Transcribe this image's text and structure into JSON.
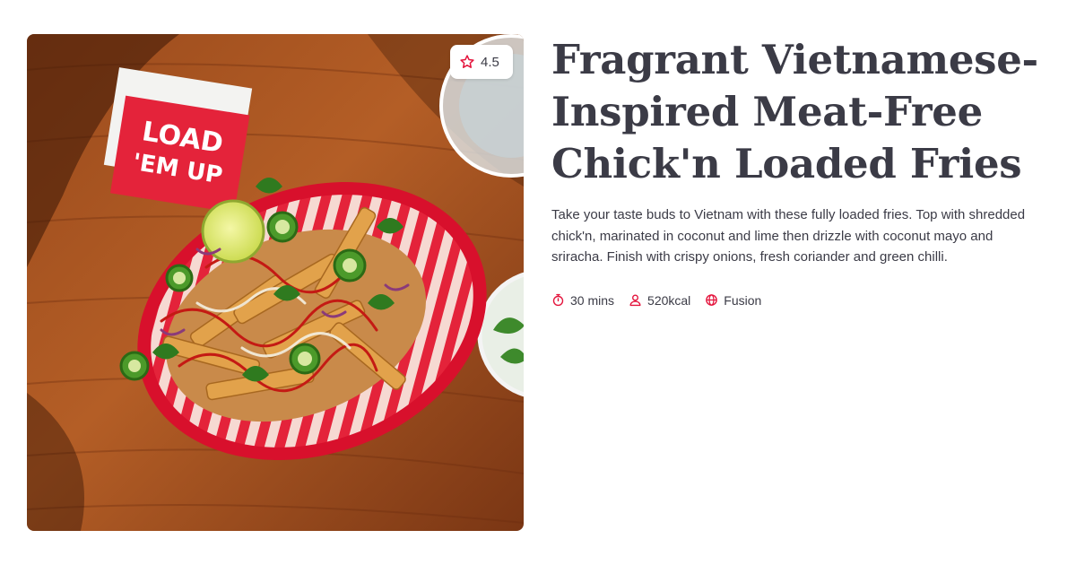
{
  "colors": {
    "accent": "#e4143c",
    "text": "#3b3b46",
    "background": "#ffffff"
  },
  "hero": {
    "rating": "4.5",
    "rating_icon": "star-outline-icon",
    "sign_text_line1": "LOAD",
    "sign_text_line2": "'EM UP"
  },
  "recipe": {
    "title": "Fragrant Vietnamese-Inspired Meat-Free Chick'n Loaded Fries",
    "description": "Take your taste buds to Vietnam with these fully loaded fries. Top with shredded chick'n, marinated in coconut and lime then drizzle with coconut mayo and sriracha. Finish with crispy onions, fresh coriander and green chilli.",
    "meta": [
      {
        "icon": "timer-icon",
        "label": "30 mins"
      },
      {
        "icon": "person-icon",
        "label": "520kcal"
      },
      {
        "icon": "globe-icon",
        "label": "Fusion"
      }
    ]
  }
}
